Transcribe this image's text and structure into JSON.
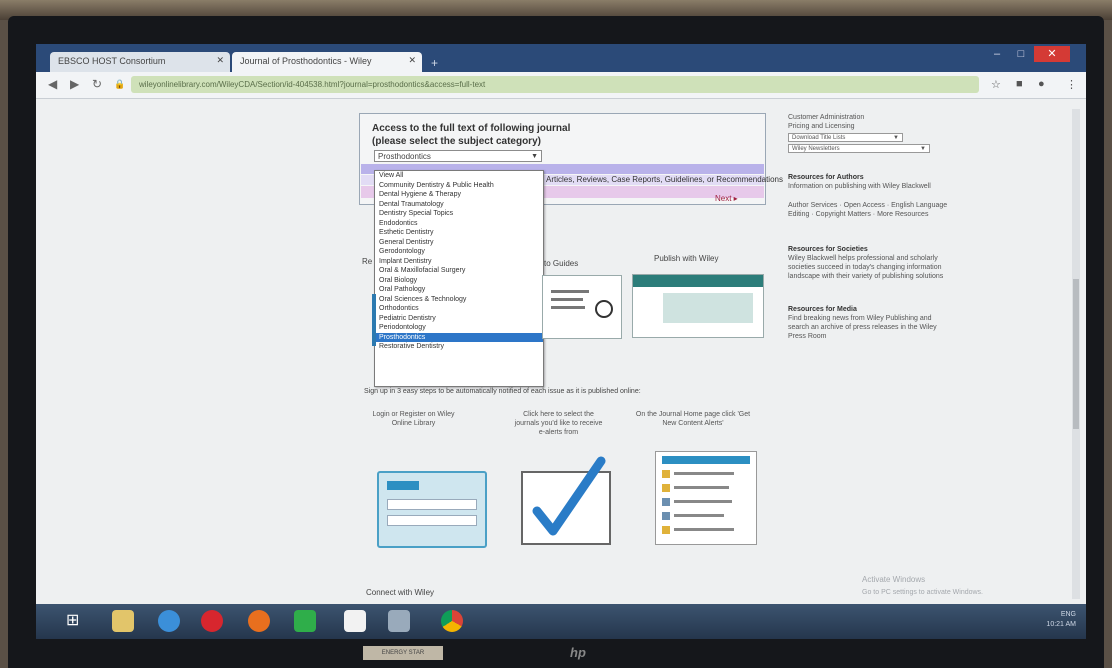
{
  "browser": {
    "tabs": [
      {
        "label": "EBSCO HOST Consortium"
      },
      {
        "label": "Journal of Prosthodontics - Wiley"
      }
    ],
    "new_tab": "+",
    "url": "wileyonlinelibrary.com/WileyCDA/Section/id-404538.html?journal=prosthodontics&access=full-text",
    "window_controls": {
      "minimize": "–",
      "maximize": "□",
      "close": "✕"
    }
  },
  "panel": {
    "title_line1": "Access to the full text of following journal",
    "title_line2": "(please select the subject category)",
    "selected_category": "Prosthodontics",
    "band_text": "Articles, Reviews, Case Reports, Guidelines, or Recommendations",
    "next_label": "Next"
  },
  "dropdown": {
    "options": [
      "View All",
      "Community Dentistry & Public Health",
      "Dental Hygiene & Therapy",
      "Dental Traumatology",
      "Dentistry Special Topics",
      "Endodontics",
      "Esthetic Dentistry",
      "General Dentistry",
      "Gerodontology",
      "Implant Dentistry",
      "Oral & Maxillofacial Surgery",
      "Oral Biology",
      "Oral Pathology",
      "Oral Sciences & Technology",
      "Orthodontics",
      "Pediatric Dentistry",
      "Periodontology",
      "Prosthodontics",
      "Restorative Dentistry"
    ],
    "highlighted_index": 17
  },
  "middle": {
    "label_left": "Re",
    "label_guides": "to Guides",
    "label_publish": "Publish with Wiley",
    "instruction": "Sign up in 3 easy steps to be automatically notified of each issue as it is published online:",
    "step1": "Login or Register on Wiley Online Library",
    "step2": "Click here to select the journals you'd like to receive e-alerts from",
    "step3": "On the Journal Home page click 'Get New Content Alerts'",
    "connect": "Connect with Wiley"
  },
  "sidebar": {
    "lines_top": [
      "Customer Administration",
      "Pricing and Licensing"
    ],
    "select1": "Download Title Lists",
    "select2": "Wiley Newsletters",
    "sections": [
      {
        "heading": "Resources for Authors",
        "text": "Information on publishing with Wiley Blackwell"
      },
      {
        "heading": "",
        "text": "Author Services · Open Access · English Language Editing · Copyright Matters · More Resources"
      },
      {
        "heading": "Resources for Societies",
        "text": "Wiley Blackwell helps professional and scholarly societies succeed in today's changing information landscape with their variety of publishing solutions"
      },
      {
        "heading": "Resources for Media",
        "text": "Find breaking news from Wiley Publishing and search an archive of press releases in the Wiley Press Room"
      }
    ]
  },
  "watermark": {
    "line1": "Activate Windows",
    "line2": "Go to PC settings to activate Windows."
  },
  "taskbar": {
    "tray_text": "ENG",
    "time": "10:21 AM"
  },
  "monitor": {
    "brand": "hp",
    "sticker": "ENERGY STAR"
  }
}
